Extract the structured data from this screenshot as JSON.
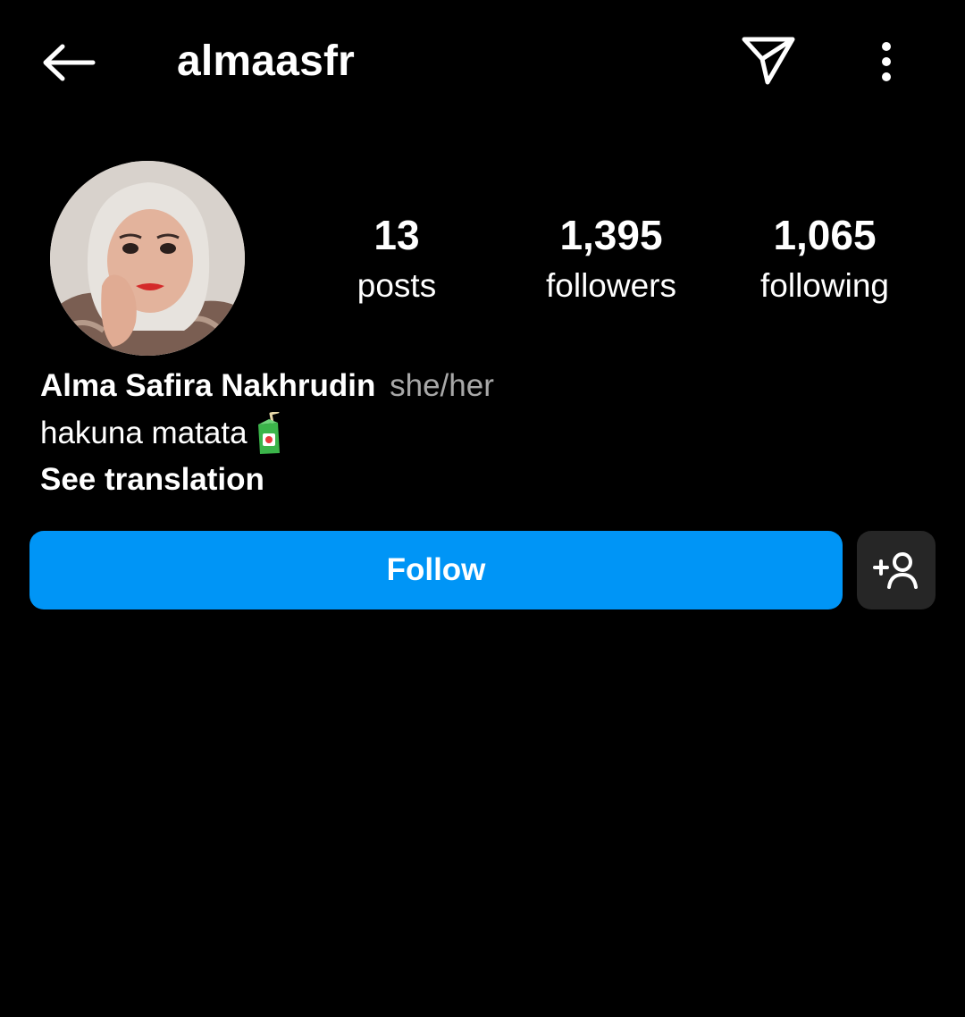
{
  "header": {
    "username": "almaasfr",
    "icons": {
      "back": "arrow-left-icon",
      "send": "paper-plane-icon",
      "more": "vertical-dots-icon"
    }
  },
  "profile": {
    "avatar_alt": "avatar",
    "stats": {
      "posts_value": "13",
      "posts_label": "posts",
      "followers_value": "1,395",
      "followers_label": "followers",
      "following_value": "1,065",
      "following_label": "following"
    },
    "full_name": "Alma Safira Nakhrudin",
    "pronouns": "she/her",
    "bio": "hakuna matata",
    "bio_emoji": "juice-box-icon",
    "see_translation": "See translation"
  },
  "actions": {
    "follow_label": "Follow",
    "suggest_icon": "add-person-icon"
  },
  "colors": {
    "background": "#000000",
    "text": "#ffffff",
    "secondary_text": "#a8a8a8",
    "follow_button": "#0095f6",
    "secondary_button": "#262626"
  }
}
